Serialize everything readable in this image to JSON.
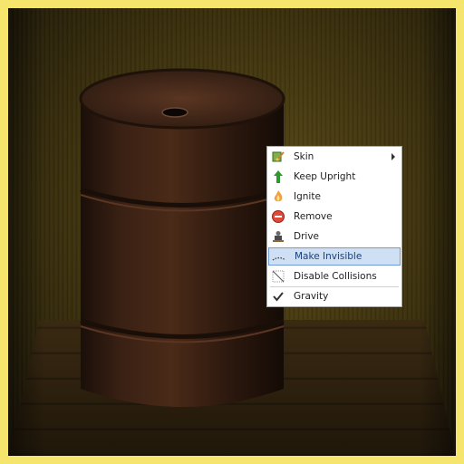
{
  "context_menu": {
    "items": [
      {
        "label": "Skin",
        "icon": "paint-brush-icon",
        "has_submenu": true
      },
      {
        "label": "Keep Upright",
        "icon": "up-arrow-icon"
      },
      {
        "label": "Ignite",
        "icon": "flame-icon"
      },
      {
        "label": "Remove",
        "icon": "remove-icon"
      },
      {
        "label": "Drive",
        "icon": "driver-icon"
      },
      {
        "label": "Make Invisible",
        "icon": "dashed-line-icon",
        "highlighted": true
      },
      {
        "label": "Disable Collisions",
        "icon": "diagonal-line-icon"
      },
      {
        "label": "Gravity",
        "icon": "checkmark-icon",
        "checked": true
      }
    ]
  },
  "colors": {
    "frame": "#f6e56c",
    "menu_highlight": "#cfe0f5",
    "menu_highlight_border": "#6f9bd6"
  }
}
